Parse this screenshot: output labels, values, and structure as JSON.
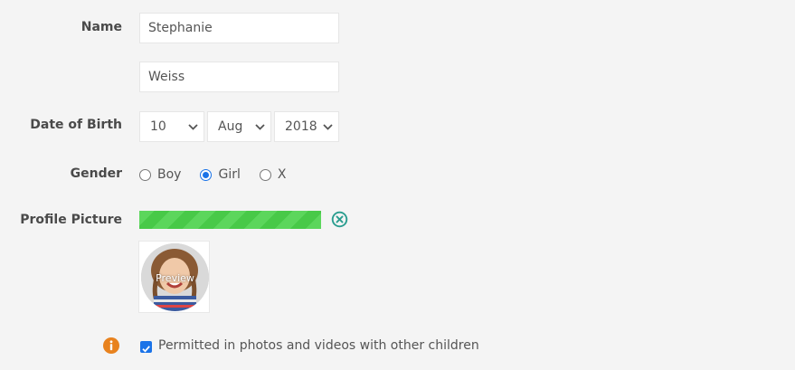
{
  "form": {
    "name": {
      "label": "Name",
      "first_value": "Stephanie",
      "last_value": "Weiss"
    },
    "dob": {
      "label": "Date of Birth",
      "day": "10",
      "month": "Aug",
      "year": "2018"
    },
    "gender": {
      "label": "Gender",
      "options": [
        "Boy",
        "Girl",
        "X"
      ],
      "selected": "Girl"
    },
    "profile_picture": {
      "label": "Profile Picture",
      "upload_progress": 1.0,
      "preview_label": "Preview"
    },
    "permission": {
      "checked": true,
      "label": "Permitted in photos and videos with other children"
    }
  },
  "colors": {
    "accent": "#1a73e8",
    "progress": "#4cc94c",
    "remove_icon": "#2a9d8f",
    "info_icon": "#e8821e"
  }
}
